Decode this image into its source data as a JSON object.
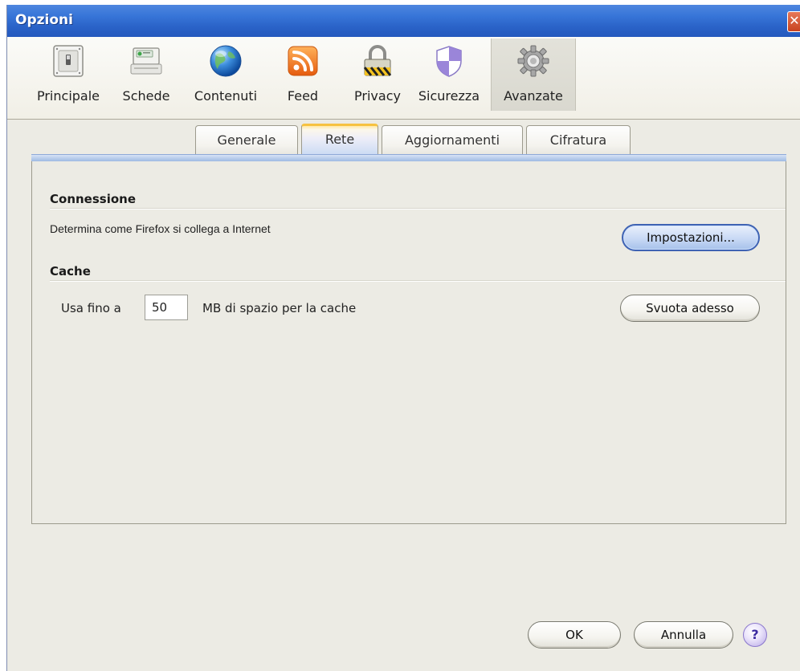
{
  "window": {
    "title": "Opzioni"
  },
  "toolbar": {
    "panes": [
      {
        "label": "Principale",
        "icon": "switch-icon"
      },
      {
        "label": "Schede",
        "icon": "tabs-icon"
      },
      {
        "label": "Contenuti",
        "icon": "globe-icon"
      },
      {
        "label": "Feed",
        "icon": "feed-icon"
      },
      {
        "label": "Privacy",
        "icon": "lock-icon"
      },
      {
        "label": "Sicurezza",
        "icon": "shield-icon"
      },
      {
        "label": "Avanzate",
        "icon": "gear-icon"
      }
    ],
    "selected": "Avanzate"
  },
  "tabs": {
    "items": [
      {
        "label": "Generale"
      },
      {
        "label": "Rete"
      },
      {
        "label": "Aggiornamenti"
      },
      {
        "label": "Cifratura"
      }
    ],
    "active": "Rete"
  },
  "connection": {
    "title": "Connessione",
    "description": "Determina come Firefox si collega a Internet",
    "settings_button": "Impostazioni..."
  },
  "cache": {
    "title": "Cache",
    "prefix": "Usa fino a",
    "value": "50",
    "suffix": "MB di spazio per la cache",
    "clear_button": "Svuota adesso"
  },
  "footer": {
    "ok_button": "OK",
    "cancel_button": "Annulla",
    "help_label": "?"
  },
  "colors": {
    "titlebar": "#2a62c7",
    "focus_border": "#3f63b3",
    "active_tab_top": "#f6c241"
  }
}
